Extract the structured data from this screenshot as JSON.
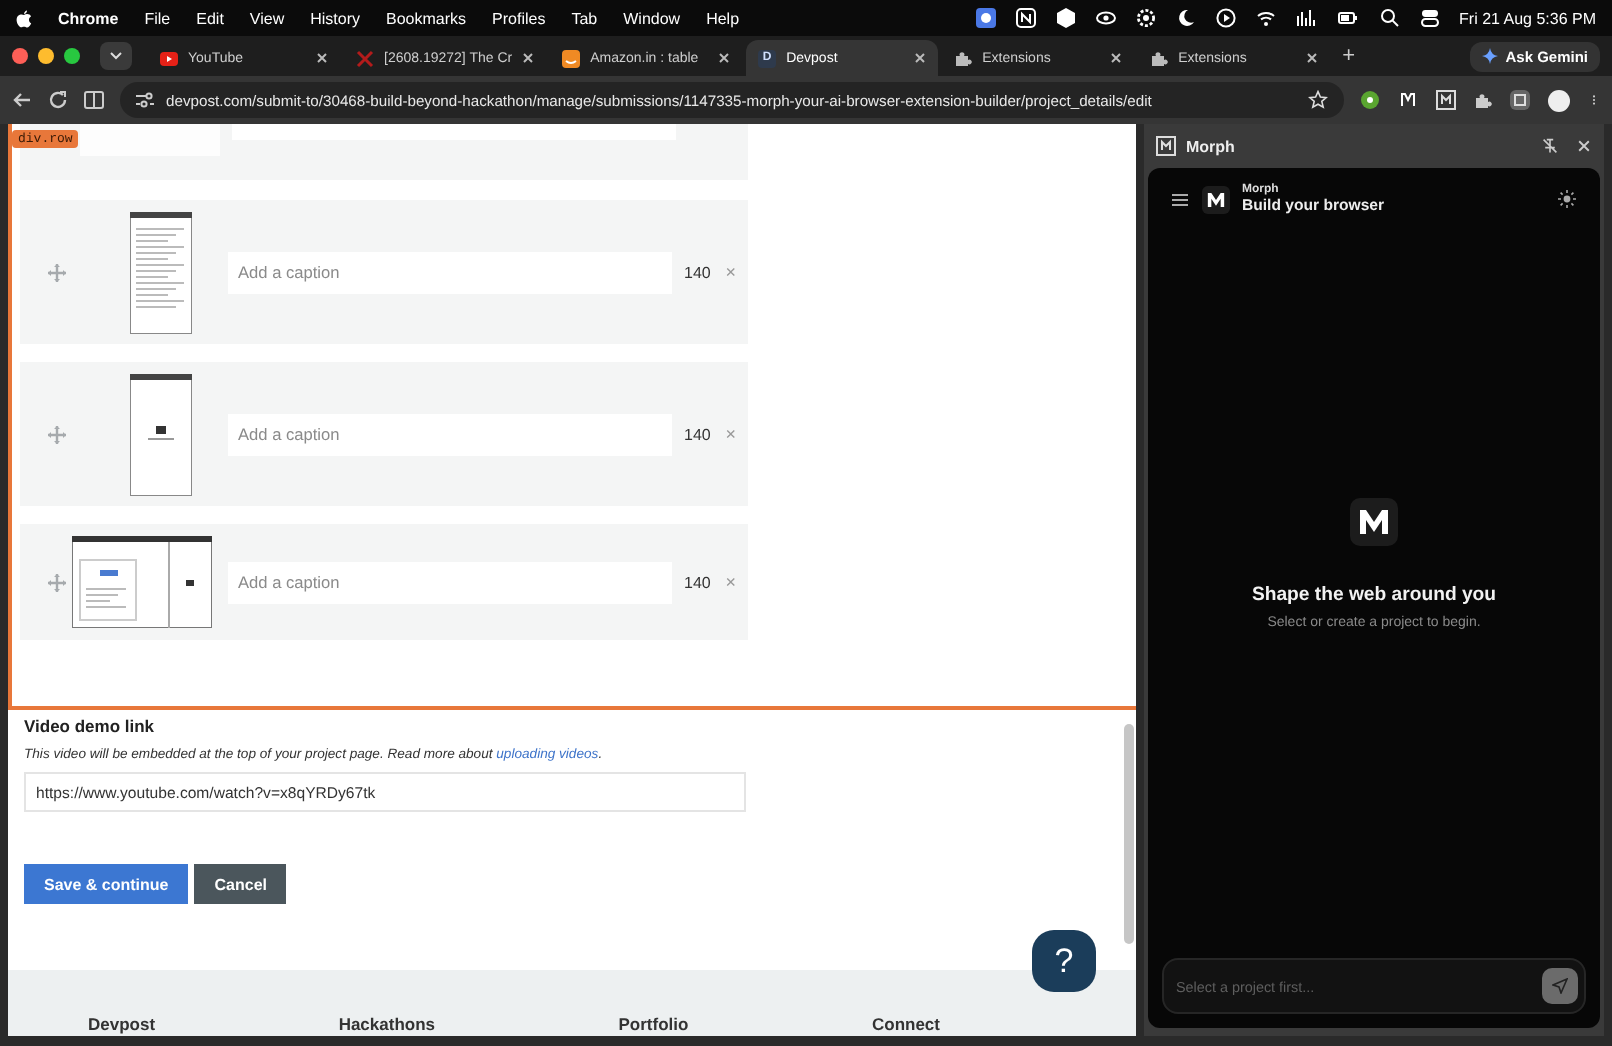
{
  "menu_bar": {
    "app": "Chrome",
    "items": [
      "File",
      "Edit",
      "View",
      "History",
      "Bookmarks",
      "Profiles",
      "Tab",
      "Window",
      "Help"
    ],
    "clock": "Fri 21 Aug  5:36 PM"
  },
  "tabs": [
    {
      "title": "YouTube",
      "kind": "video",
      "selected": false
    },
    {
      "title": "[2608.19272] The Cr",
      "kind": "paper",
      "selected": false
    },
    {
      "title": "Amazon.in : table",
      "kind": "shop",
      "selected": false
    },
    {
      "title": "Devpost",
      "kind": "letter",
      "letter": "D",
      "selected": true
    },
    {
      "title": "Extensions",
      "kind": "extension",
      "selected": false
    },
    {
      "title": "Extensions",
      "kind": "extension",
      "selected": false
    }
  ],
  "new_tab": "+",
  "ask_button": "Ask Gemini",
  "address_bar": {
    "url": "devpost.com/submit-to/30468-build-beyond-hackathon/manage/submissions/1147335-morph-your-ai-browser-extension-builder/project_details/edit"
  },
  "page": {
    "inspector_label": "div.row",
    "media_rows": [
      {
        "kind": "portrait-text",
        "placeholder": "Add a caption",
        "count": "140",
        "remove": "×"
      },
      {
        "kind": "portrait-blank",
        "placeholder": "Add a caption",
        "count": "140",
        "remove": "×"
      },
      {
        "kind": "landscape",
        "placeholder": "Add a caption",
        "count": "140",
        "remove": "×"
      }
    ],
    "video": {
      "label": "Video demo link",
      "help": "This video will be embedded at the top of your project page. Read more about ",
      "link": "uploading videos",
      "help_end": ".",
      "value": "https://www.youtube.com/watch?v=x8qYRDy67tk"
    },
    "buttons": [
      {
        "label": "Save & continue",
        "kind": "primary"
      },
      {
        "label": "Cancel",
        "kind": "secondary"
      }
    ],
    "help_button": "?",
    "footer": [
      "Devpost",
      "Hackathons",
      "Portfolio",
      "Connect"
    ]
  },
  "side_panel": {
    "title": "Morph",
    "app_name": "Morph",
    "app_subtitle": "Build your browser",
    "heading": "Shape the web around you",
    "subtext": "Select or create a project to begin.",
    "input_placeholder": "Select a project first..."
  }
}
